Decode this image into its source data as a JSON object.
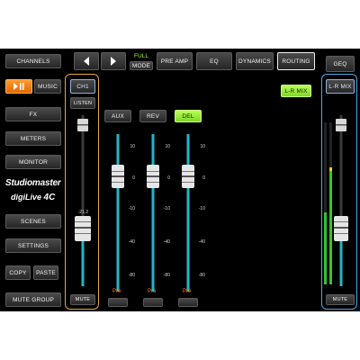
{
  "left_panel": {
    "channels": "CHANNELS",
    "music": "MUSIC",
    "fx": "FX",
    "meters": "METERS",
    "monitor": "MONITOR",
    "scenes": "SCENES",
    "settings": "SETTINGS",
    "copy": "COPY",
    "paste": "PASTE",
    "mute_group": "MUTE GROUP"
  },
  "logo": {
    "brand": "Studiomaster",
    "model_a": "digiLive",
    "model_b": "4C"
  },
  "top_bar": {
    "full_label": "FULL",
    "mode_label": "MODE",
    "tabs": [
      "PRE AMP",
      "EQ",
      "DYNAMICS",
      "ROUTING"
    ],
    "active_tab": "ROUTING",
    "geq": "GEQ"
  },
  "channel_strip": {
    "name": "CH1",
    "listen": "LISTEN",
    "fader_value": "-21.2",
    "mute": "MUTE"
  },
  "routing": {
    "lr_mix": "L-R MIX",
    "buses": [
      "AUX",
      "REV",
      "DEL"
    ],
    "active_bus": "DEL",
    "scale": [
      "10",
      "0",
      "-10",
      "-40",
      "-80"
    ],
    "pre_labels": [
      "Pre",
      "Pre",
      "Pre"
    ]
  },
  "master_strip": {
    "name": "L-R MIX",
    "fader_value": "-21.2",
    "mute": "MUTE"
  },
  "colors": {
    "accent_green": "#9cff3c",
    "fader_track": "#1fb6c9",
    "orange": "#ff8a2a",
    "channel_border": "#e8a24a",
    "master_border": "#4aa8e8"
  }
}
